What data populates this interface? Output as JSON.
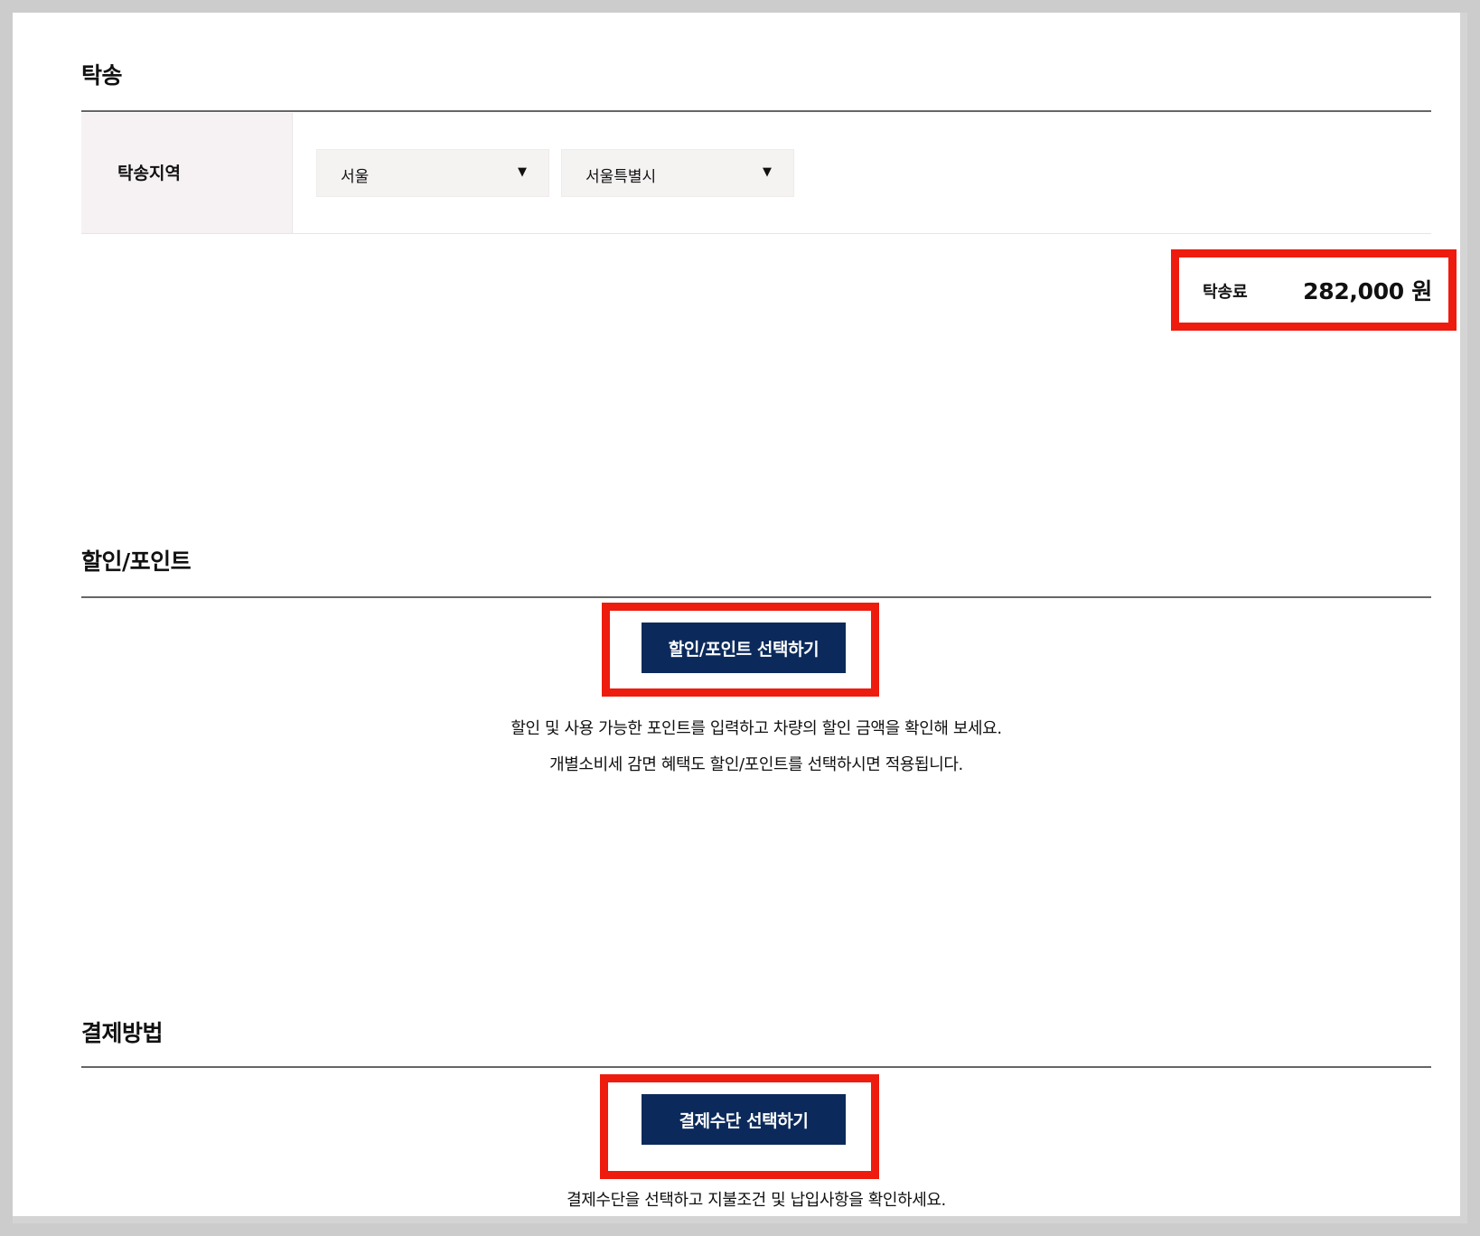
{
  "delivery": {
    "title": "탁송",
    "region_label": "탁송지역",
    "region_select_1": "서울",
    "region_select_2": "서울특별시",
    "caret": "▼",
    "fee_label": "탁송료",
    "fee_amount": "282,000 원"
  },
  "discount": {
    "title": "할인/포인트",
    "button_label": "할인/포인트 선택하기",
    "desc_line1": "할인 및 사용 가능한 포인트를 입력하고 차량의 할인 금액을 확인해 보세요.",
    "desc_line2": "개별소비세 감면 혜택도 할인/포인트를 선택하시면 적용됩니다."
  },
  "payment": {
    "title": "결제방법",
    "button_label": "결제수단 선택하기",
    "desc_line1": "결제수단을 선택하고 지불조건 및 납입사항을 확인하세요."
  },
  "colors": {
    "button_bg": "#0b2a5b",
    "highlight_red": "#ee1c0e",
    "label_cell_bg": "#f6f2f3",
    "select_bg": "#f5f2f2"
  }
}
